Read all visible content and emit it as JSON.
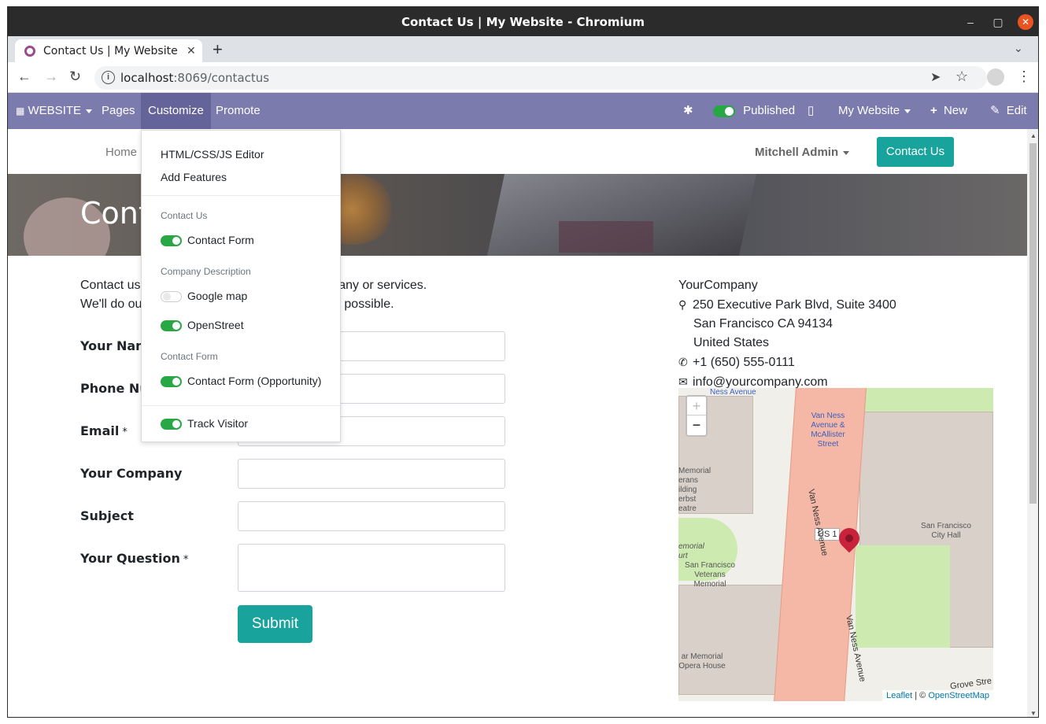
{
  "window": {
    "title": "Contact Us | My Website - Chromium"
  },
  "browser": {
    "tab_title": "Contact Us | My Website",
    "url_host": "localhost",
    "url_path": ":8069/contactus"
  },
  "odoo_bar": {
    "website_label": "WEBSITE",
    "pages_label": "Pages",
    "customize_label": "Customize",
    "promote_label": "Promote",
    "published_label": "Published",
    "my_website_label": "My Website",
    "new_label": "New",
    "edit_label": "Edit"
  },
  "site_nav": {
    "home_label": "Home",
    "user_label": "Mitchell Admin",
    "contact_button": "Contact Us"
  },
  "banner": {
    "title": "Contact us"
  },
  "intro": {
    "line1": "Contact us about anything related to our company or services.",
    "line2": "We'll do our best to get back to you as soon as possible."
  },
  "form": {
    "your_name": "Your Name",
    "phone_number": "Phone Number",
    "email": "Email",
    "your_company": "Your Company",
    "subject": "Subject",
    "your_question": "Your Question",
    "required_mark": "*",
    "submit_label": "Submit"
  },
  "company": {
    "name": "YourCompany",
    "street": "250 Executive Park Blvd, Suite 3400",
    "city": "San Francisco CA 94134",
    "country": "United States",
    "phone": "+1 (650) 555-0111",
    "email": "info@yourcompany.com"
  },
  "map": {
    "zoom_in": "+",
    "zoom_out": "−",
    "label_ness_avenue": "Ness Avenue",
    "label_stop": "Van Ness Avenue & McAllister Street",
    "label_memorial_left": "Memorial erans ilding erbst eatre",
    "label_memorial_court": "emorial urt",
    "label_sf_veterans": "San Francisco Veterans Memorial",
    "label_city_hall": "San Francisco City Hall",
    "label_us": "US 1",
    "label_van_ness_1": "Van Ness Avenue",
    "label_van_ness_2": "Van Ness Avenue",
    "label_opera": "ar Memorial Opera House",
    "label_grove": "Grove Stre",
    "attr_leaflet": "Leaflet",
    "attr_sep": " | © ",
    "attr_osm": "OpenStreetMap"
  },
  "dropdown": {
    "html_editor": "HTML/CSS/JS Editor",
    "add_features": "Add Features",
    "section_contact_us": "Contact Us",
    "contact_form": "Contact Form",
    "section_company_desc": "Company Description",
    "google_map": "Google map",
    "openstreet": "OpenStreet",
    "section_contact_form": "Contact Form",
    "contact_form_opportunity": "Contact Form (Opportunity)",
    "track_visitor": "Track Visitor"
  },
  "colors": {
    "odoo_bar": "#7c7bad",
    "primary": "#18a39c",
    "toggle_on": "#28a745"
  }
}
